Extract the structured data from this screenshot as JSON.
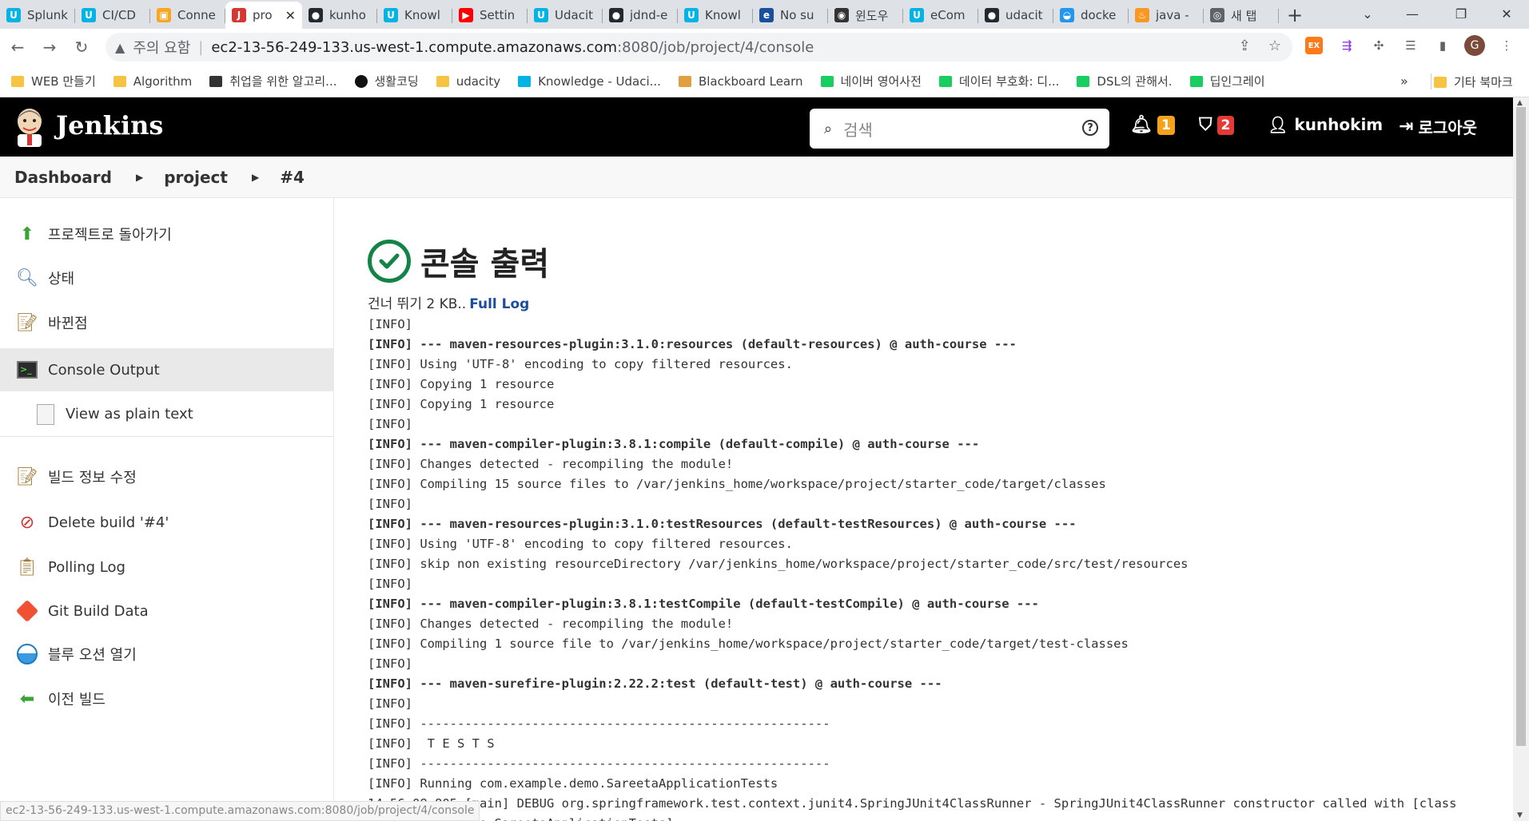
{
  "browser": {
    "tabs": [
      {
        "label": "Splunk",
        "icon": "udacity-icon",
        "color": "#02b3e4",
        "glyph": "U"
      },
      {
        "label": "CI/CD",
        "icon": "udacity-icon",
        "color": "#02b3e4",
        "glyph": "U"
      },
      {
        "label": "Conne",
        "icon": "aws-box-icon",
        "color": "#f5a623",
        "glyph": "▣"
      },
      {
        "label": "pro",
        "icon": "jenkins-icon",
        "color": "#d33833",
        "glyph": "J",
        "active": true
      },
      {
        "label": "kunho",
        "icon": "github-icon",
        "color": "#24292e",
        "glyph": "●"
      },
      {
        "label": "Knowl",
        "icon": "udacity-icon",
        "color": "#02b3e4",
        "glyph": "U"
      },
      {
        "label": "Settin",
        "icon": "youtube-icon",
        "color": "#ff0000",
        "glyph": "▶"
      },
      {
        "label": "Udacit",
        "icon": "udacity-icon",
        "color": "#02b3e4",
        "glyph": "U"
      },
      {
        "label": "jdnd-e",
        "icon": "github-icon",
        "color": "#24292e",
        "glyph": "●"
      },
      {
        "label": "Knowl",
        "icon": "udacity-icon",
        "color": "#02b3e4",
        "glyph": "U"
      },
      {
        "label": "No su",
        "icon": "error-e-icon",
        "color": "#1a4f9d",
        "glyph": "e"
      },
      {
        "label": "윈도우",
        "icon": "mask-icon",
        "color": "#333333",
        "glyph": "◉"
      },
      {
        "label": "eCom",
        "icon": "udacity-icon",
        "color": "#02b3e4",
        "glyph": "U"
      },
      {
        "label": "udacit",
        "icon": "github-icon",
        "color": "#24292e",
        "glyph": "●"
      },
      {
        "label": "docke",
        "icon": "docker-icon",
        "color": "#2496ed",
        "glyph": "◒"
      },
      {
        "label": "java -",
        "icon": "java-icon",
        "color": "#f89820",
        "glyph": "♨"
      },
      {
        "label": "새 탭",
        "icon": "chrome-icon",
        "color": "#5f6368",
        "glyph": "◎"
      }
    ],
    "new_tab": "+",
    "window_controls": {
      "minimize": "—",
      "restore": "❐",
      "close": "✕"
    },
    "nav": {
      "back": "←",
      "forward": "→",
      "reload": "↻"
    },
    "security_label": "주의 요함",
    "url_host": "ec2-13-56-249-133.us-west-1.compute.amazonaws.com",
    "url_path": ":8080/job/project/4/console",
    "profile_initial": "G",
    "bookmarks": [
      {
        "label": "WEB 만들기",
        "icon": "folder-icon",
        "color": "#f6c443"
      },
      {
        "label": "Algorithm",
        "icon": "folder-icon",
        "color": "#f6c443"
      },
      {
        "label": "취업을 위한 알고리...",
        "icon": "dots-icon",
        "color": "#333333"
      },
      {
        "label": "생활코딩",
        "icon": "circle-icon",
        "color": "#111111"
      },
      {
        "label": "udacity",
        "icon": "folder-icon",
        "color": "#f6c443"
      },
      {
        "label": "Knowledge - Udaci...",
        "icon": "udacity-icon",
        "color": "#02b3e4"
      },
      {
        "label": "Blackboard Learn",
        "icon": "pencil-icon",
        "color": "#e0a040"
      },
      {
        "label": "네이버 영어사전",
        "icon": "naver-icon",
        "color": "#19ce60"
      },
      {
        "label": "데이터 부호화: 디...",
        "icon": "blog-icon",
        "color": "#19ce60"
      },
      {
        "label": "DSL의 관해서.",
        "icon": "chat-icon",
        "color": "#19ce60"
      },
      {
        "label": "딥인그레이",
        "icon": "shield-icon",
        "color": "#19ce60"
      }
    ],
    "bookmarks_more": "»",
    "other_bookmarks": "기타 북마크",
    "status_url": "ec2-13-56-249-133.us-west-1.compute.amazonaws.com:8080/job/project/4/console"
  },
  "jenkins": {
    "title": "Jenkins",
    "search_placeholder": "검색",
    "notifications_count": "1",
    "security_count": "2",
    "username": "kunhokim",
    "logout_label": "로그아웃",
    "colors": {
      "notif_badge": "#f2a21b",
      "security_badge": "#e53935",
      "success": "#138347",
      "link": "#1a4f9d"
    }
  },
  "breadcrumb": [
    "Dashboard",
    "project",
    "#4"
  ],
  "sidebar": {
    "items": [
      {
        "label": "프로젝트로 돌아가기",
        "icon": "up-arrow-icon"
      },
      {
        "label": "상태",
        "icon": "magnifier-icon"
      },
      {
        "label": "바뀐점",
        "icon": "notepad-icon"
      },
      {
        "label": "Console Output",
        "icon": "terminal-icon"
      },
      {
        "label": "View as plain text",
        "icon": "document-icon"
      },
      {
        "label": "빌드 정보 수정",
        "icon": "notepad-icon"
      },
      {
        "label": "Delete build '#4'",
        "icon": "no-entry-icon"
      },
      {
        "label": "Polling Log",
        "icon": "clipboard-icon"
      },
      {
        "label": "Git Build Data",
        "icon": "git-icon"
      },
      {
        "label": "블루 오션 열기",
        "icon": "blue-ocean-icon"
      },
      {
        "label": "이전 빌드",
        "icon": "back-arrow-icon"
      }
    ]
  },
  "console": {
    "title": "콘솔 출력",
    "skip_text": "건너 뛰기 2 KB..",
    "full_log_label": "Full Log",
    "lines": [
      "[INFO]",
      "[INFO] --- maven-resources-plugin:3.1.0:resources (default-resources) @ auth-course ---",
      "[INFO] Using 'UTF-8' encoding to copy filtered resources.",
      "[INFO] Copying 1 resource",
      "[INFO] Copying 1 resource",
      "[INFO]",
      "[INFO] --- maven-compiler-plugin:3.8.1:compile (default-compile) @ auth-course ---",
      "[INFO] Changes detected - recompiling the module!",
      "[INFO] Compiling 15 source files to /var/jenkins_home/workspace/project/starter_code/target/classes",
      "[INFO]",
      "[INFO] --- maven-resources-plugin:3.1.0:testResources (default-testResources) @ auth-course ---",
      "[INFO] Using 'UTF-8' encoding to copy filtered resources.",
      "[INFO] skip non existing resourceDirectory /var/jenkins_home/workspace/project/starter_code/src/test/resources",
      "[INFO]",
      "[INFO] --- maven-compiler-plugin:3.8.1:testCompile (default-testCompile) @ auth-course ---",
      "[INFO] Changes detected - recompiling the module!",
      "[INFO] Compiling 1 source file to /var/jenkins_home/workspace/project/starter_code/target/test-classes",
      "[INFO]",
      "[INFO] --- maven-surefire-plugin:2.22.2:test (default-test) @ auth-course ---",
      "[INFO]",
      "[INFO] -------------------------------------------------------",
      "[INFO]  T E S T S",
      "[INFO] -------------------------------------------------------",
      "[INFO] Running com.example.demo.SareetaApplicationTests",
      "14:56:08.805 [main] DEBUG org.springframework.test.context.junit4.SpringJUnit4ClassRunner - SpringJUnit4ClassRunner constructor called with [class",
      "com.example.demo.SareetaApplicationTests]"
    ]
  }
}
